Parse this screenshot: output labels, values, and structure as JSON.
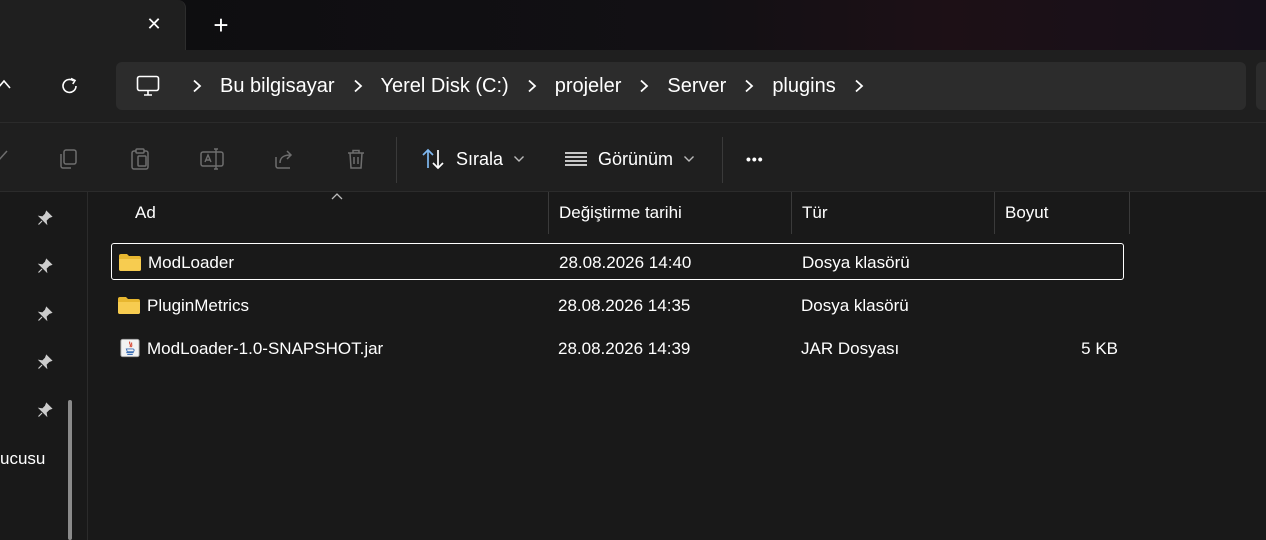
{
  "titlebar": {
    "close_glyph": "✕",
    "newtab_glyph": "+"
  },
  "breadcrumb": [
    "Bu bilgisayar",
    "Yerel Disk (C:)",
    "projeler",
    "Server",
    "plugins"
  ],
  "commands": {
    "sort_label": "Sırala",
    "view_label": "Görünüm",
    "more_glyph": "•••"
  },
  "sidebar": {
    "partial_label": "ucusu",
    "pin_count": 5
  },
  "columns": {
    "name": "Ad",
    "modified": "Değiştirme tarihi",
    "type": "Tür",
    "size": "Boyut"
  },
  "files": [
    {
      "name": "ModLoader",
      "modified": "28.08.2026 14:40",
      "type": "Dosya klasörü",
      "size": "",
      "icon": "folder-icon",
      "selected": true
    },
    {
      "name": "PluginMetrics",
      "modified": "28.08.2026 14:35",
      "type": "Dosya klasörü",
      "size": "",
      "icon": "folder-icon",
      "selected": false
    },
    {
      "name": "ModLoader-1.0-SNAPSHOT.jar",
      "modified": "28.08.2026 14:39",
      "type": "JAR Dosyası",
      "size": "5 KB",
      "icon": "java-file-icon",
      "selected": false
    }
  ],
  "colors": {
    "background": "#191919",
    "chrome": "#1f1f1f",
    "addressbar": "#2c2c2c",
    "folder": "#f3c54a"
  }
}
